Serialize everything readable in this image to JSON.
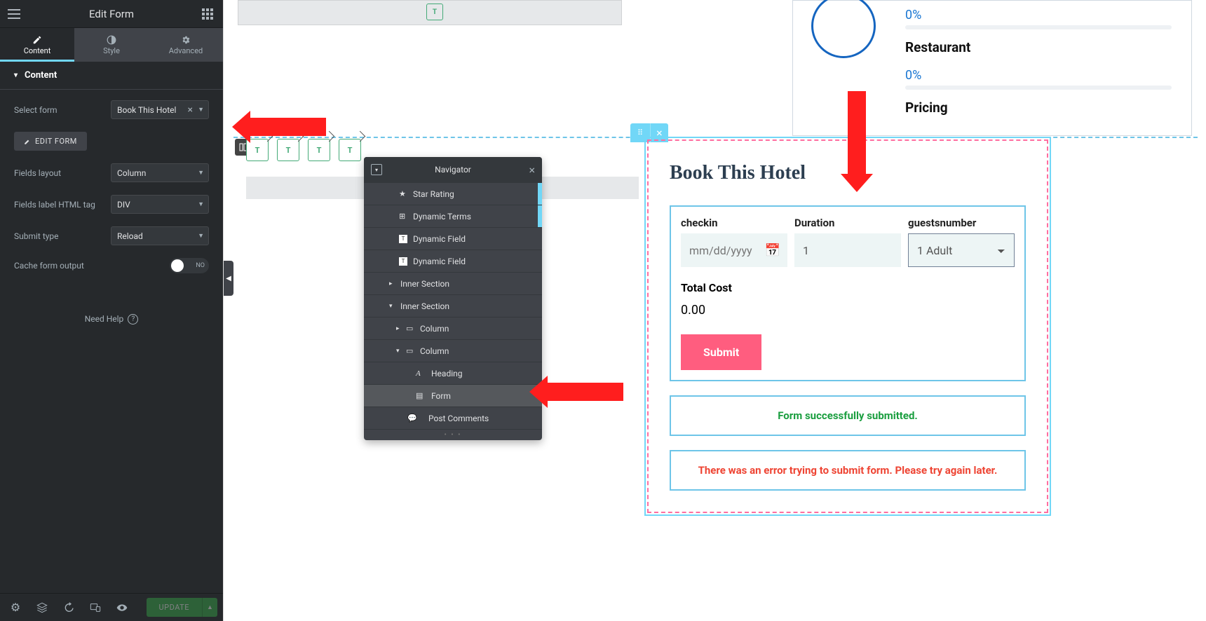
{
  "sidebar": {
    "title": "Edit Form",
    "tabs": {
      "content": "Content",
      "style": "Style",
      "advanced": "Advanced"
    },
    "section_head": "Content",
    "select_form_label": "Select form",
    "select_form_value": "Book This Hotel",
    "edit_form_btn": "EDIT FORM",
    "fields_layout_label": "Fields layout",
    "fields_layout_value": "Column",
    "html_tag_label": "Fields label HTML tag",
    "html_tag_value": "DIV",
    "submit_type_label": "Submit type",
    "submit_type_value": "Reload",
    "cache_label": "Cache form output",
    "cache_value": "NO",
    "help": "Need Help",
    "update": "UPDATE"
  },
  "navigator": {
    "title": "Navigator",
    "items": [
      {
        "label": "Star Rating",
        "icon": "★"
      },
      {
        "label": "Dynamic Terms",
        "icon": "⊞"
      },
      {
        "label": "Dynamic Field",
        "icon": "T"
      },
      {
        "label": "Dynamic Field",
        "icon": "T"
      },
      {
        "label": "Inner Section",
        "caret": "▸"
      },
      {
        "label": "Inner Section",
        "caret": "▾"
      },
      {
        "label": "Column",
        "caret": "▸",
        "icon": "▭"
      },
      {
        "label": "Column",
        "caret": "▾",
        "icon": "▭"
      },
      {
        "label": "Heading",
        "icon": "A"
      },
      {
        "label": "Form",
        "icon": "▤",
        "selected": true
      },
      {
        "label": "Post Comments",
        "icon": "💬"
      }
    ]
  },
  "preview": {
    "stats": [
      {
        "pct": "0%",
        "label": "Restaurant"
      },
      {
        "pct": "0%",
        "label": "Pricing"
      }
    ],
    "form_title": "Book This Hotel",
    "fields": {
      "checkin": {
        "label": "checkin",
        "placeholder": "mm/dd/yyyy"
      },
      "duration": {
        "label": "Duration",
        "value": "1"
      },
      "guests": {
        "label": "guestsnumber",
        "value": "1 Adult"
      }
    },
    "total_label": "Total Cost",
    "total_value": "0.00",
    "submit": "Submit",
    "success_msg": "Form successfully submitted.",
    "error_msg": "There was an error trying to submit form. Please try again later."
  }
}
